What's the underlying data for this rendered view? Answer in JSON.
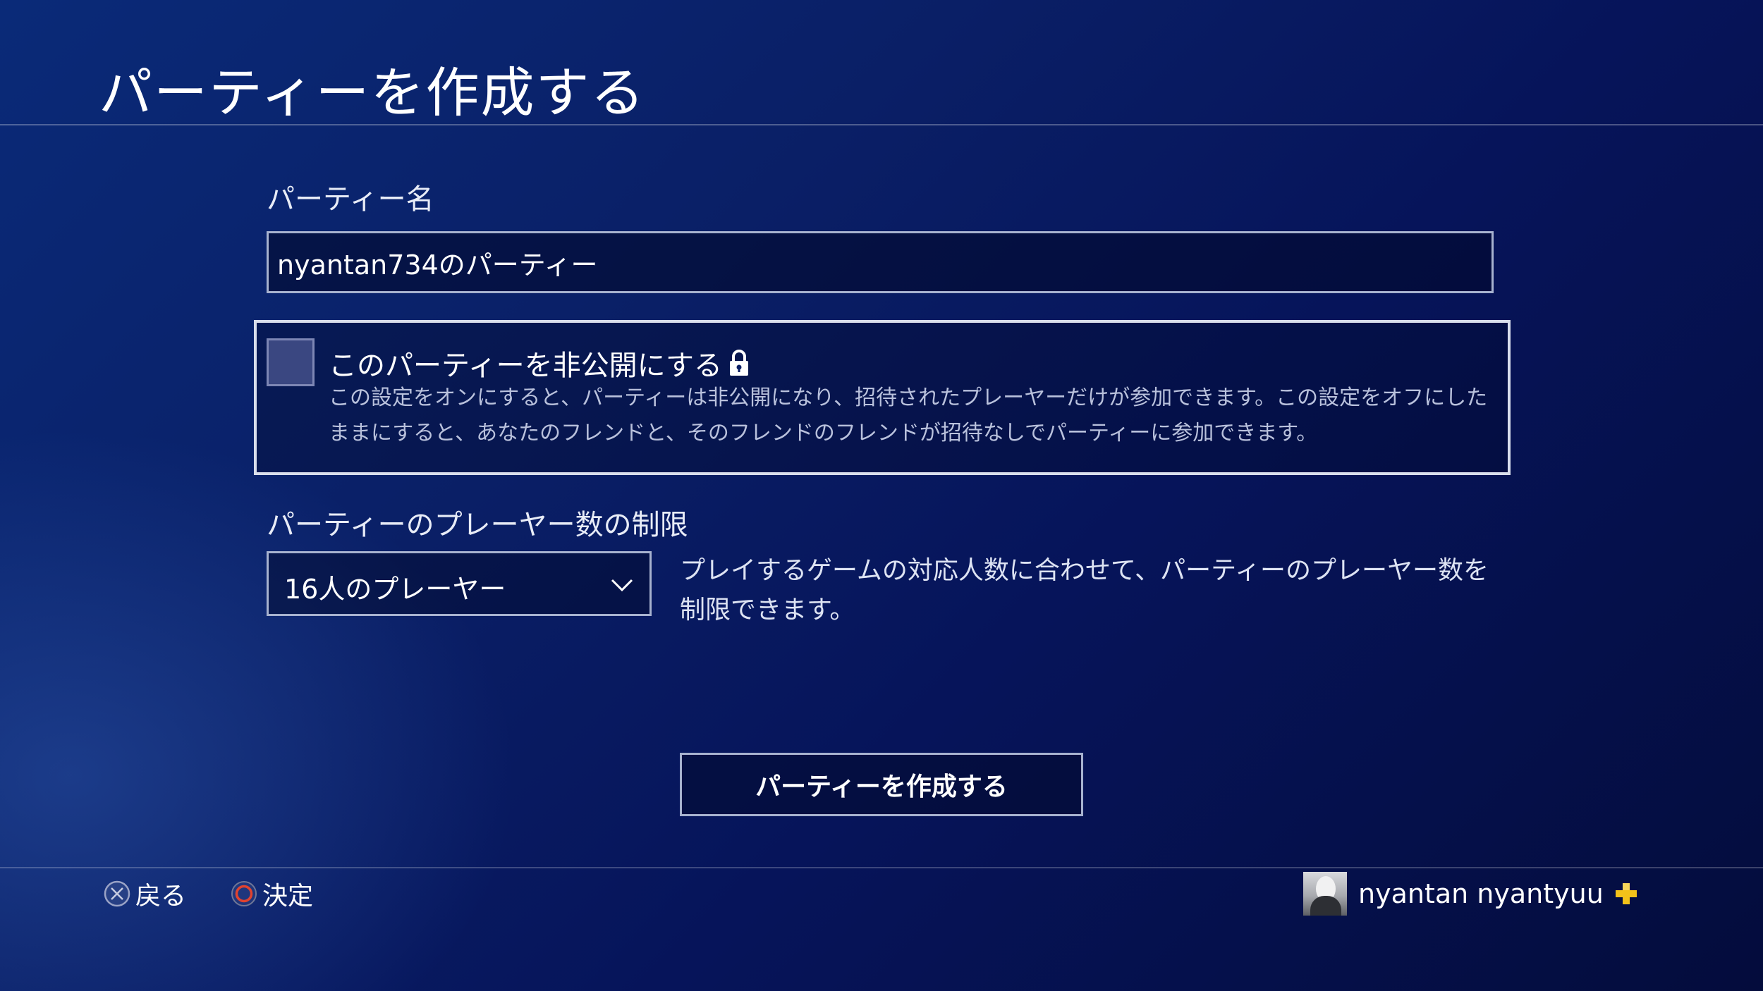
{
  "header": {
    "title": "パーティーを作成する"
  },
  "form": {
    "party_name_label": "パーティー名",
    "party_name_value": "nyantan734のパーティー",
    "private": {
      "title": "このパーティーを非公開にする",
      "checked": false,
      "description": "この設定をオンにすると、パーティーは非公開になり、招待されたプレーヤーだけが参加できます。この設定をオフにしたままにすると、あなたのフレンドと、そのフレンドのフレンドが招待なしでパーティーに参加できます。"
    },
    "limit_label": "パーティーのプレーヤー数の制限",
    "limit_value": "16人のプレーヤー",
    "limit_help": "プレイするゲームの対応人数に合わせて、パーティーのプレーヤー数を制限できます。"
  },
  "actions": {
    "create_label": "パーティーを作成する"
  },
  "footer": {
    "back_label": "戻る",
    "confirm_label": "決定",
    "user_name": "nyantan nyantyuu"
  },
  "colors": {
    "background": "#0a1f66",
    "accent_plus": "#f3c21a",
    "cross_button": "#9aa3c6",
    "circle_button": "#e0432f"
  }
}
